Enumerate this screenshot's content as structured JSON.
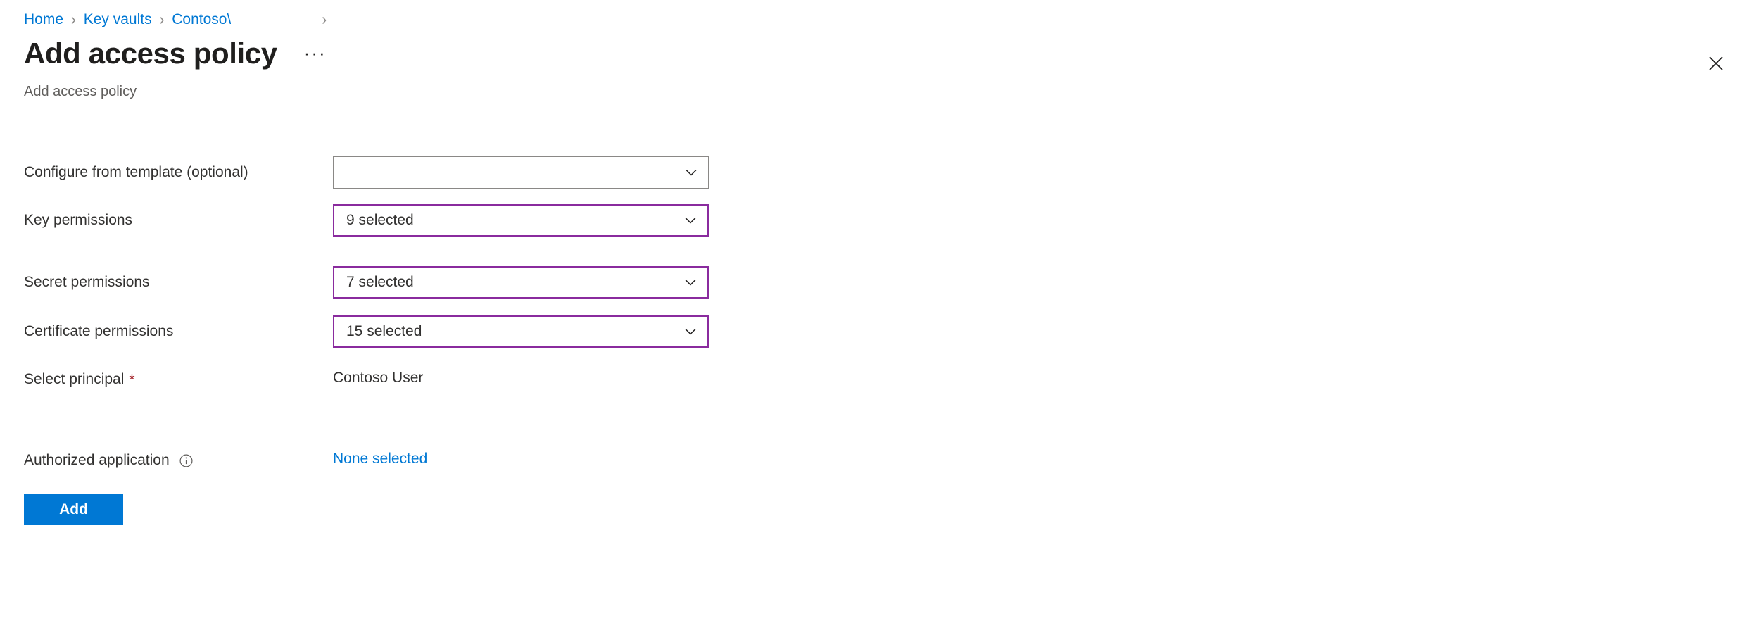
{
  "breadcrumb": {
    "items": [
      {
        "label": "Home"
      },
      {
        "label": "Key vaults"
      },
      {
        "label": "Contoso\\"
      }
    ],
    "separator": "›"
  },
  "header": {
    "title": "Add access policy",
    "subtitle": "Add access policy",
    "more_label": "···",
    "close_icon": "close-icon"
  },
  "colors": {
    "link": "#0078d4",
    "accent_border": "#8a2b9e",
    "neutral_border": "#8a8886",
    "required": "#a4262c",
    "primary_button": "#0078d4",
    "text": "#323130",
    "subtle_text": "#605e5c"
  },
  "form": {
    "rows": [
      {
        "label": "Configure from template (optional)",
        "type": "dropdown",
        "value": "",
        "placeholder": "",
        "accent": false,
        "required": false
      },
      {
        "label": "Key permissions",
        "type": "dropdown",
        "value": "9 selected",
        "placeholder": "",
        "accent": true,
        "required": false
      },
      {
        "label": "Secret permissions",
        "type": "dropdown",
        "value": "7 selected",
        "placeholder": "",
        "accent": true,
        "required": false
      },
      {
        "label": "Certificate permissions",
        "type": "dropdown",
        "value": "15 selected",
        "placeholder": "",
        "accent": true,
        "required": false
      },
      {
        "label": "Select principal",
        "type": "text",
        "value": "Contoso User",
        "required": true
      },
      {
        "label": "Authorized application",
        "type": "link",
        "value": "None selected",
        "required": false,
        "info": true
      }
    ]
  },
  "actions": {
    "add_label": "Add"
  }
}
